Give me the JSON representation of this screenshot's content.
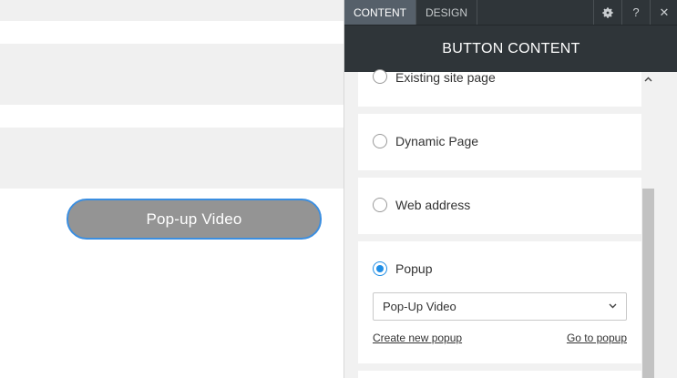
{
  "canvas": {
    "button_label": "Pop-up Video"
  },
  "panel": {
    "tabs": [
      {
        "label": "CONTENT",
        "active": true
      },
      {
        "label": "DESIGN",
        "active": false
      }
    ],
    "icons": {
      "settings": "gear-icon",
      "help": "help-icon",
      "close": "close-icon"
    },
    "help_glyph": "?",
    "close_glyph": "✕",
    "title": "BUTTON CONTENT",
    "options": [
      {
        "label": "Existing site page",
        "checked": false
      },
      {
        "label": "Dynamic Page",
        "checked": false
      },
      {
        "label": "Web address",
        "checked": false
      },
      {
        "label": "Popup",
        "checked": true
      }
    ],
    "popup_select": {
      "value": "Pop-Up Video"
    },
    "create_link": "Create new popup",
    "goto_link": "Go to popup"
  },
  "colors": {
    "panel_header": "#2f3539",
    "accent": "#1f8ee6",
    "button_fill": "#949494",
    "button_border": "#3b8ee0"
  }
}
